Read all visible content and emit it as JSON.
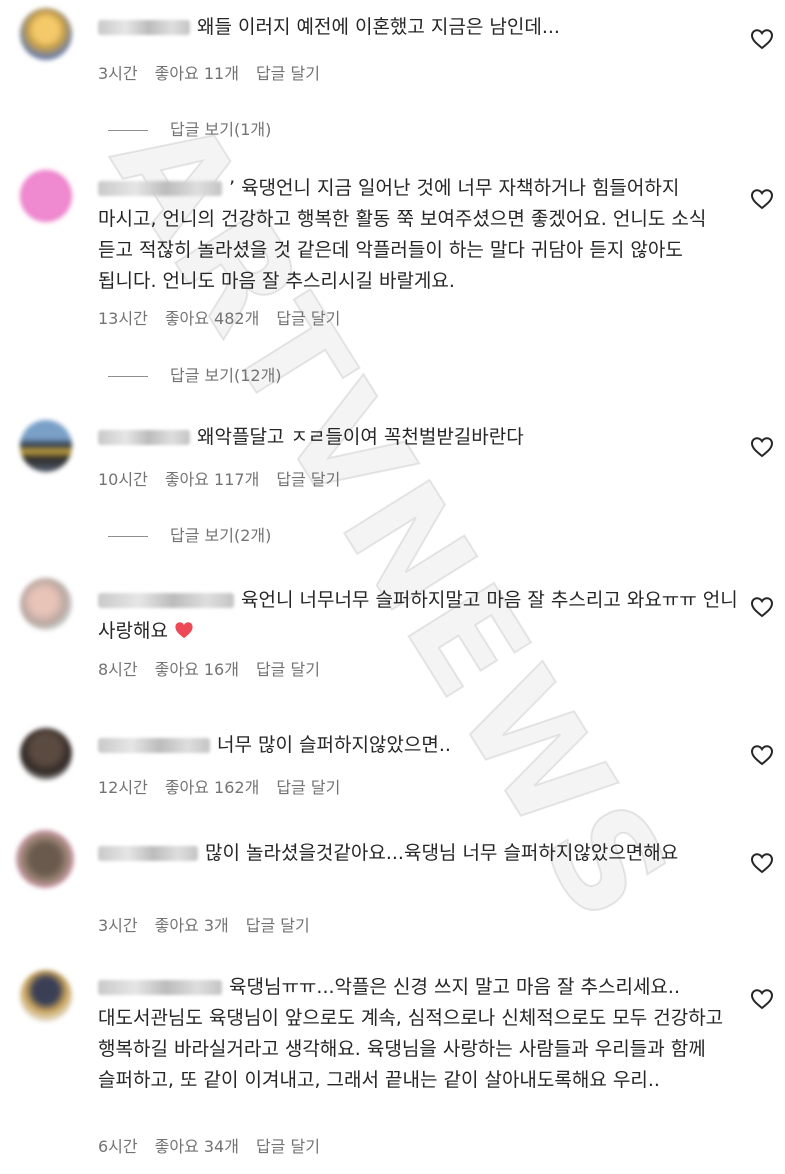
{
  "watermark": "ARTVNEWS",
  "comments": [
    {
      "text": "왜들 이러지 예전에 이혼했고 지금은 남인데...",
      "time": "3시간",
      "likes": "좋아요 11개",
      "reply_label": "답글 달기",
      "view_replies": "답글 보기(1개)"
    },
    {
      "text": "’ 육댕언니 지금 일어난 것에 너무 자책하거나 힘들어하지 마시고, 언니의 건강하고 행복한 활동 쭉 보여주셨으면 좋겠어요. 언니도 소식 듣고 적잖히 놀라셨을 것 같은데 악플러들이 하는 말다 귀담아 듣지 않아도 됩니다. 언니도 마음 잘 추스리시길 바랄게요.",
      "time": "13시간",
      "likes": "좋아요 482개",
      "reply_label": "답글 달기",
      "view_replies": "답글 보기(12개)"
    },
    {
      "text": "왜악플달고 ㅈㄹ들이여 꼭천벌받길바란다",
      "time": "10시간",
      "likes": "좋아요 117개",
      "reply_label": "답글 달기",
      "view_replies": "답글 보기(2개)"
    },
    {
      "text": "육언니 너무너무 슬퍼하지말고 마음 잘 추스리고 와요ㅠㅠ 언니 사랑해요",
      "time": "8시간",
      "likes": "좋아요 16개",
      "reply_label": "답글 달기"
    },
    {
      "text": "너무 많이 슬퍼하지않았으면..",
      "time": "12시간",
      "likes": "좋아요 162개",
      "reply_label": "답글 달기"
    },
    {
      "text": "많이 놀라셨을것같아요...육댕님 너무 슬퍼하지않았으면해요",
      "time": "3시간",
      "likes": "좋아요 3개",
      "reply_label": "답글 달기"
    },
    {
      "text": "육댕님ㅠㅠ...악플은 신경 쓰지 말고 마음 잘 추스리세요.. 대도서관님도 육댕님이 앞으로도 계속, 심적으로나 신체적으로도 모두 건강하고 행복하길 바라실거라고 생각해요. 육댕님을 사랑하는 사람들과 우리들과 함께 슬퍼하고, 또 같이 이겨내고, 그래서 끝내는 같이 살아내도록해요 우리..",
      "time": "6시간",
      "likes": "좋아요 34개",
      "reply_label": "답글 달기"
    }
  ],
  "colors": {
    "text": "#262626",
    "meta": "#737373",
    "heart_emoji": "#ed4956"
  },
  "icons": {
    "like": "heart-outline-icon",
    "emoji": "red-heart-emoji-icon"
  }
}
